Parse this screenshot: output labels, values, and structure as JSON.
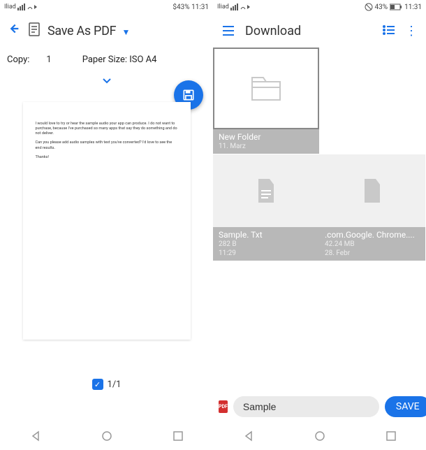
{
  "left": {
    "status": {
      "carrier": "Iliad",
      "battery_time": "$43% 11:31"
    },
    "header": {
      "title": "Save As PDF"
    },
    "options": {
      "copy_label": "Copy:",
      "copies": "1",
      "paper_size": "Paper Size: ISO A4"
    },
    "preview": {
      "para1": "I would love to try or hear the sample audio your app can produce. I do not want to purchase, because I've purchased so many apps that say they do something and do not deliver.",
      "para2": "Can you please add audio samples with text you've converted? I'd love to see the end results.",
      "para3": "Thanks!"
    },
    "pager": "1/1"
  },
  "right": {
    "status": {
      "carrier": "Iliad",
      "battery": "43%",
      "time": "11:31"
    },
    "header": {
      "title": "Download"
    },
    "files": [
      {
        "name": "New Folder",
        "meta1": "11. Marz",
        "meta2": ""
      },
      {
        "name": "Sample. Txt",
        "meta1": "282 B",
        "meta2": "11:29"
      },
      {
        "name": ".com.Google. Chrome....",
        "meta1": "42.24 MB",
        "meta2": "28. Febr"
      }
    ],
    "filename": "Sample",
    "pdf_badge": "PDF",
    "save_label": "SAVE"
  }
}
